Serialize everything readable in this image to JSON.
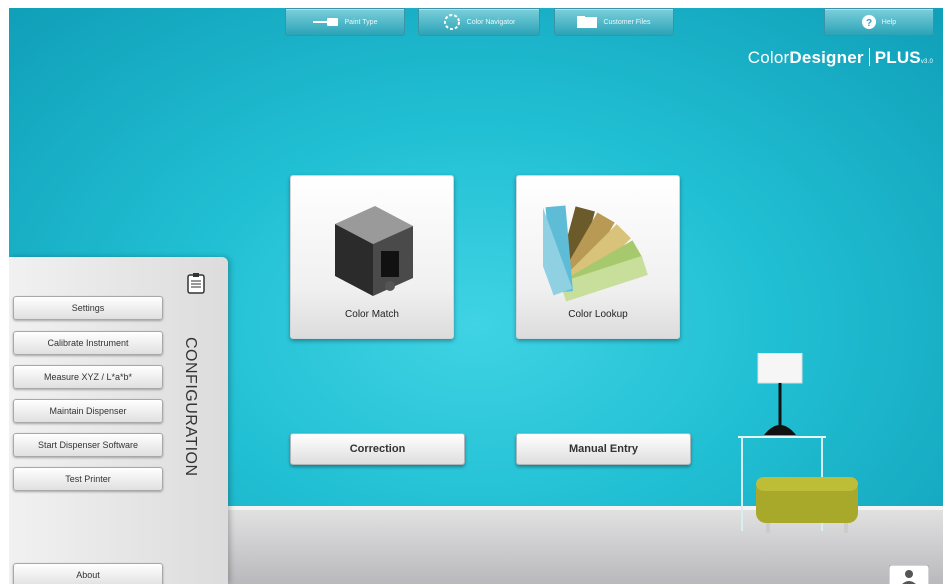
{
  "toolbar": {
    "paint_type": "Paint Type",
    "color_navigator": "Color Navigator",
    "customer_files": "Customer Files",
    "help": "Help"
  },
  "brand": {
    "color": "Color",
    "designer": "Designer",
    "plus": "PLUS",
    "version": "v3.0"
  },
  "main": {
    "color_match": "Color Match",
    "color_lookup": "Color Lookup",
    "correction": "Correction",
    "manual_entry": "Manual Entry"
  },
  "config": {
    "title": "CONFIGURATION",
    "items": [
      "Settings",
      "Calibrate Instrument",
      "Measure XYZ / L*a*b*",
      "Maintain Dispenser",
      "Start Dispenser Software",
      "Test Printer"
    ],
    "about": "About"
  },
  "colors": {
    "background": "#21bfd3",
    "floor": "#cfcfd2",
    "ottoman": "#a8a82a"
  }
}
